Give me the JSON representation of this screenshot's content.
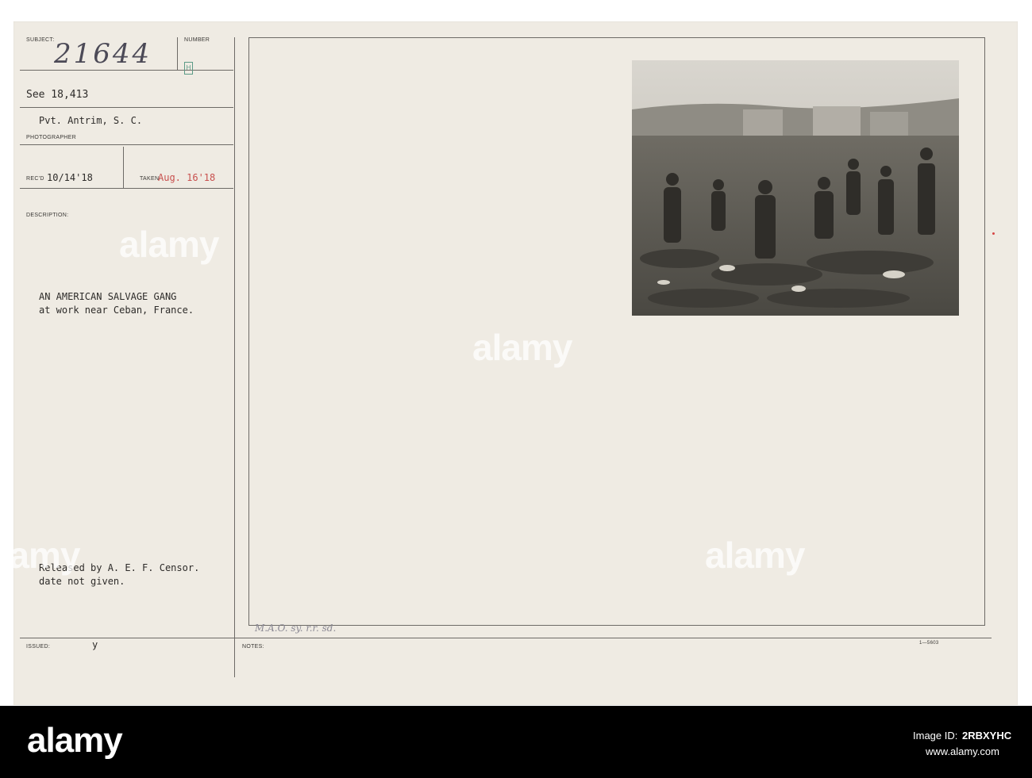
{
  "card": {
    "subject_label": "SUBJECT:",
    "subject_value": "21644",
    "number_label": "NUMBER",
    "number_stamp": "H",
    "see_ref": "See 18,413",
    "photographer_name": "Pvt. Antrim, S. C.",
    "photographer_label": "PHOTOGRAPHER",
    "recd_label": "REC'D",
    "recd_date": "10/14'18",
    "taken_label": "TAKEN",
    "taken_date": "Aug. 16'18",
    "description_label": "DESCRIPTION:",
    "description_line1": "AN AMERICAN SALVAGE GANG",
    "description_line2": "at work near Ceban, France.",
    "release_line1": "Released by A. E. F. Censor.",
    "release_line2": "date not given.",
    "issued_label": "ISSUED:",
    "issued_value": "y",
    "notes_label": "NOTES:",
    "handwritten_note": "M.A.O. sy. r.r. sd.",
    "form_number": "1—5603"
  },
  "watermark": {
    "text": "alamy"
  },
  "footer": {
    "logo": "alamy",
    "image_id_label": "Image ID:",
    "image_id": "2RBXYHC",
    "site": "www.alamy.com"
  }
}
